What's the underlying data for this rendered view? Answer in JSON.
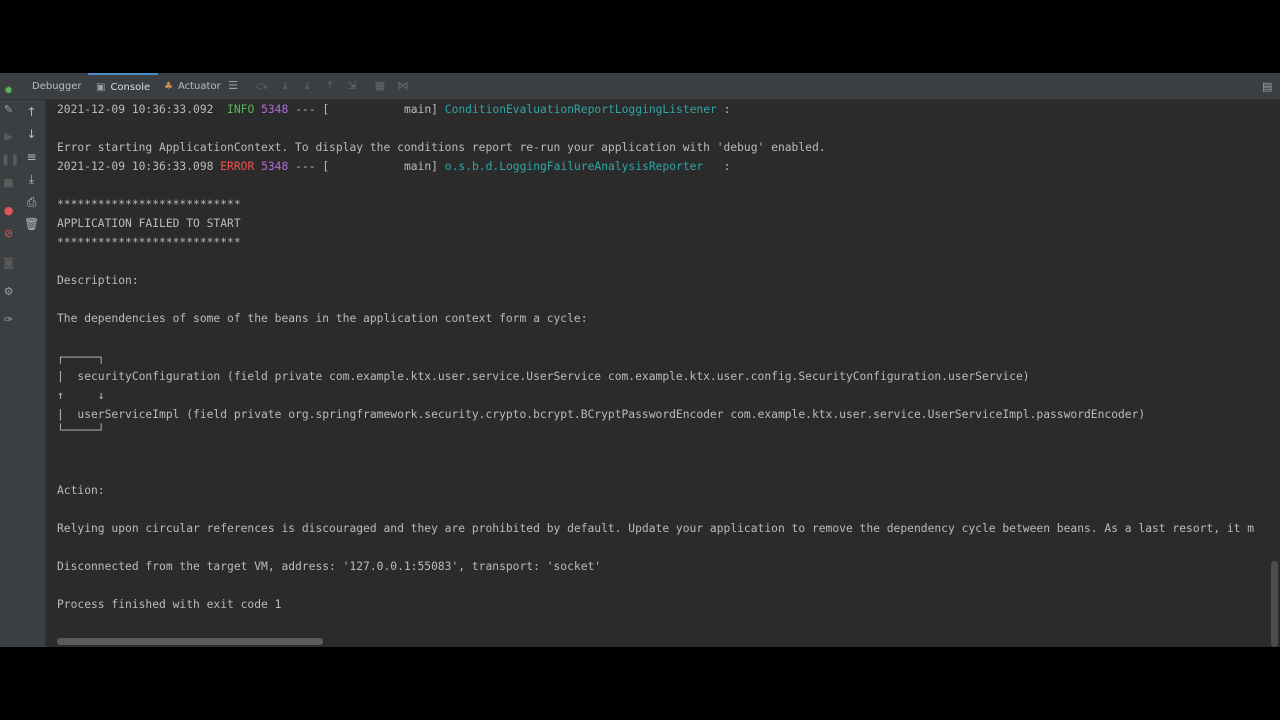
{
  "tabs": [
    {
      "label": "Debugger",
      "icon": "debugger-icon"
    },
    {
      "label": "Console",
      "icon": "console-icon"
    },
    {
      "label": "Actuator",
      "icon": "actuator-icon"
    }
  ],
  "console": {
    "log1": {
      "timestamp": "2021-12-09 10:36:33.092",
      "level": "INFO",
      "pid": "5348",
      "sep": "--- [",
      "thread": "main]",
      "logger": "ConditionEvaluationReportLoggingListener",
      "colon": ":"
    },
    "err_ctx": "Error starting ApplicationContext. To display the conditions report re-run your application with 'debug' enabled.",
    "log2": {
      "timestamp": "2021-12-09 10:36:33.098",
      "level": "ERROR",
      "pid": "5348",
      "sep": "--- [",
      "thread": "main]",
      "logger": "o.s.b.d.LoggingFailureAnalysisReporter",
      "colon": ":"
    },
    "stars1": "***************************",
    "failed": "APPLICATION FAILED TO START",
    "stars2": "***************************",
    "desc_label": "Description:",
    "desc_text": "The dependencies of some of the beans in the application context form a cycle:",
    "cycle_top": "┌─────┐",
    "cycle_1": "|  securityConfiguration (field private com.example.ktx.user.service.UserService com.example.ktx.user.config.SecurityConfiguration.userService)",
    "cycle_arrows": "↑     ↓",
    "cycle_2": "|  userServiceImpl (field private org.springframework.security.crypto.bcrypt.BCryptPasswordEncoder com.example.ktx.user.service.UserServiceImpl.passwordEncoder)",
    "cycle_bottom": "└─────┘",
    "action_label": "Action:",
    "action_text": "Relying upon circular references is discouraged and they are prohibited by default. Update your application to remove the dependency cycle between beans. As a last resort, it m",
    "disconnected": "Disconnected from the target VM, address: '127.0.0.1:55083', transport: 'socket'",
    "exit": "Process finished with exit code 1"
  },
  "colors": {
    "background": "#2b2b2b",
    "panel": "#3c3f41",
    "text": "#bbbbbb",
    "info": "#5bb55a",
    "error": "#f0524f",
    "pid": "#b06cd6",
    "logger": "#2fa6a6",
    "accent": "#4a88c7"
  }
}
